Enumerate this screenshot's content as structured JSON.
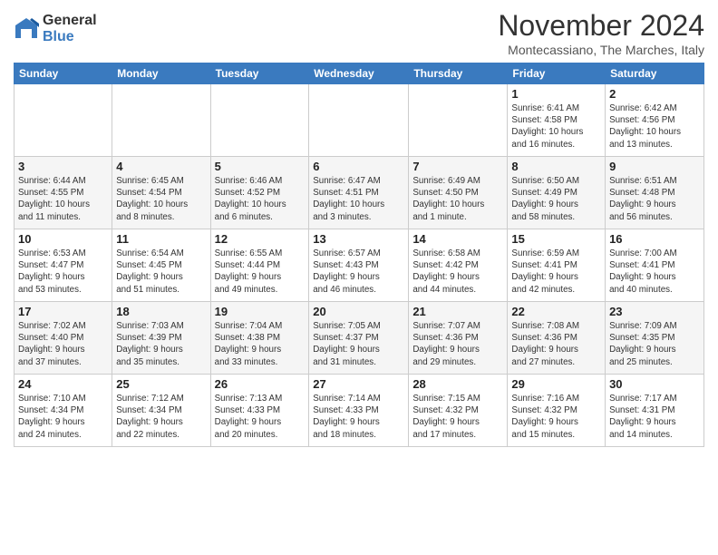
{
  "logo": {
    "general": "General",
    "blue": "Blue"
  },
  "title": "November 2024",
  "location": "Montecassiano, The Marches, Italy",
  "headers": [
    "Sunday",
    "Monday",
    "Tuesday",
    "Wednesday",
    "Thursday",
    "Friday",
    "Saturday"
  ],
  "weeks": [
    [
      {
        "day": "",
        "info": ""
      },
      {
        "day": "",
        "info": ""
      },
      {
        "day": "",
        "info": ""
      },
      {
        "day": "",
        "info": ""
      },
      {
        "day": "",
        "info": ""
      },
      {
        "day": "1",
        "info": "Sunrise: 6:41 AM\nSunset: 4:58 PM\nDaylight: 10 hours\nand 16 minutes."
      },
      {
        "day": "2",
        "info": "Sunrise: 6:42 AM\nSunset: 4:56 PM\nDaylight: 10 hours\nand 13 minutes."
      }
    ],
    [
      {
        "day": "3",
        "info": "Sunrise: 6:44 AM\nSunset: 4:55 PM\nDaylight: 10 hours\nand 11 minutes."
      },
      {
        "day": "4",
        "info": "Sunrise: 6:45 AM\nSunset: 4:54 PM\nDaylight: 10 hours\nand 8 minutes."
      },
      {
        "day": "5",
        "info": "Sunrise: 6:46 AM\nSunset: 4:52 PM\nDaylight: 10 hours\nand 6 minutes."
      },
      {
        "day": "6",
        "info": "Sunrise: 6:47 AM\nSunset: 4:51 PM\nDaylight: 10 hours\nand 3 minutes."
      },
      {
        "day": "7",
        "info": "Sunrise: 6:49 AM\nSunset: 4:50 PM\nDaylight: 10 hours\nand 1 minute."
      },
      {
        "day": "8",
        "info": "Sunrise: 6:50 AM\nSunset: 4:49 PM\nDaylight: 9 hours\nand 58 minutes."
      },
      {
        "day": "9",
        "info": "Sunrise: 6:51 AM\nSunset: 4:48 PM\nDaylight: 9 hours\nand 56 minutes."
      }
    ],
    [
      {
        "day": "10",
        "info": "Sunrise: 6:53 AM\nSunset: 4:47 PM\nDaylight: 9 hours\nand 53 minutes."
      },
      {
        "day": "11",
        "info": "Sunrise: 6:54 AM\nSunset: 4:45 PM\nDaylight: 9 hours\nand 51 minutes."
      },
      {
        "day": "12",
        "info": "Sunrise: 6:55 AM\nSunset: 4:44 PM\nDaylight: 9 hours\nand 49 minutes."
      },
      {
        "day": "13",
        "info": "Sunrise: 6:57 AM\nSunset: 4:43 PM\nDaylight: 9 hours\nand 46 minutes."
      },
      {
        "day": "14",
        "info": "Sunrise: 6:58 AM\nSunset: 4:42 PM\nDaylight: 9 hours\nand 44 minutes."
      },
      {
        "day": "15",
        "info": "Sunrise: 6:59 AM\nSunset: 4:41 PM\nDaylight: 9 hours\nand 42 minutes."
      },
      {
        "day": "16",
        "info": "Sunrise: 7:00 AM\nSunset: 4:41 PM\nDaylight: 9 hours\nand 40 minutes."
      }
    ],
    [
      {
        "day": "17",
        "info": "Sunrise: 7:02 AM\nSunset: 4:40 PM\nDaylight: 9 hours\nand 37 minutes."
      },
      {
        "day": "18",
        "info": "Sunrise: 7:03 AM\nSunset: 4:39 PM\nDaylight: 9 hours\nand 35 minutes."
      },
      {
        "day": "19",
        "info": "Sunrise: 7:04 AM\nSunset: 4:38 PM\nDaylight: 9 hours\nand 33 minutes."
      },
      {
        "day": "20",
        "info": "Sunrise: 7:05 AM\nSunset: 4:37 PM\nDaylight: 9 hours\nand 31 minutes."
      },
      {
        "day": "21",
        "info": "Sunrise: 7:07 AM\nSunset: 4:36 PM\nDaylight: 9 hours\nand 29 minutes."
      },
      {
        "day": "22",
        "info": "Sunrise: 7:08 AM\nSunset: 4:36 PM\nDaylight: 9 hours\nand 27 minutes."
      },
      {
        "day": "23",
        "info": "Sunrise: 7:09 AM\nSunset: 4:35 PM\nDaylight: 9 hours\nand 25 minutes."
      }
    ],
    [
      {
        "day": "24",
        "info": "Sunrise: 7:10 AM\nSunset: 4:34 PM\nDaylight: 9 hours\nand 24 minutes."
      },
      {
        "day": "25",
        "info": "Sunrise: 7:12 AM\nSunset: 4:34 PM\nDaylight: 9 hours\nand 22 minutes."
      },
      {
        "day": "26",
        "info": "Sunrise: 7:13 AM\nSunset: 4:33 PM\nDaylight: 9 hours\nand 20 minutes."
      },
      {
        "day": "27",
        "info": "Sunrise: 7:14 AM\nSunset: 4:33 PM\nDaylight: 9 hours\nand 18 minutes."
      },
      {
        "day": "28",
        "info": "Sunrise: 7:15 AM\nSunset: 4:32 PM\nDaylight: 9 hours\nand 17 minutes."
      },
      {
        "day": "29",
        "info": "Sunrise: 7:16 AM\nSunset: 4:32 PM\nDaylight: 9 hours\nand 15 minutes."
      },
      {
        "day": "30",
        "info": "Sunrise: 7:17 AM\nSunset: 4:31 PM\nDaylight: 9 hours\nand 14 minutes."
      }
    ]
  ]
}
